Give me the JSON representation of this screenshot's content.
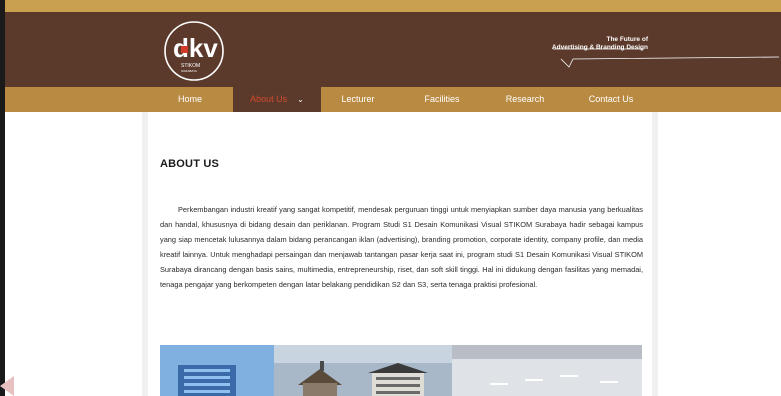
{
  "brand": {
    "logo_letters": "dkv",
    "logo_org": "STIKOM",
    "logo_city": "SURABAYA",
    "tagline_line1": "The Future of",
    "tagline_line2": "Advertising & Branding Design"
  },
  "nav": {
    "items": [
      {
        "label": "Home"
      },
      {
        "label": "About Us"
      },
      {
        "label": "Lecturer"
      },
      {
        "label": "Facilities"
      },
      {
        "label": "Research"
      },
      {
        "label": "Contact Us"
      }
    ],
    "active_index": 1,
    "dropdown_glyph": "⌄"
  },
  "page": {
    "title": "ABOUT US",
    "body": "Perkembangan industri kreatif yang sangat kompetitif, mendesak perguruan tinggi untuk menyiapkan sumber daya manusia yang berkualitas dan handal, khususnya di bidang desain dan periklanan. Program Studi S1 Desain Komunikasi Visual STIKOM Surabaya hadir sebagai kampus yang siap mencetak lulusannya dalam bidang perancangan iklan (advertising), branding promotion, corporate identity, company profile, dan media kreatif lainnya. Untuk menghadapi persaingan dan menjawab tantangan pasar kerja saat ini, program studi S1 Desain Komunikasi Visual STIKOM Surabaya dirancang dengan basis sains, multimedia, entrepreneurship, riset, dan soft skill tinggi. Hal ini didukung dengan fasilitas yang memadai, tenaga pengajar yang berkompeten dengan latar belakang pendidikan S2 dan S3, serta tenaga praktisi profesional."
  },
  "colors": {
    "header_brown": "#5b3a2c",
    "nav_gold": "#b98a42",
    "top_gold": "#c8a050",
    "active_text": "#d24a2c"
  },
  "icons": {
    "dropdown": "chevron-down-icon",
    "logo": "dkv-logo-icon"
  }
}
